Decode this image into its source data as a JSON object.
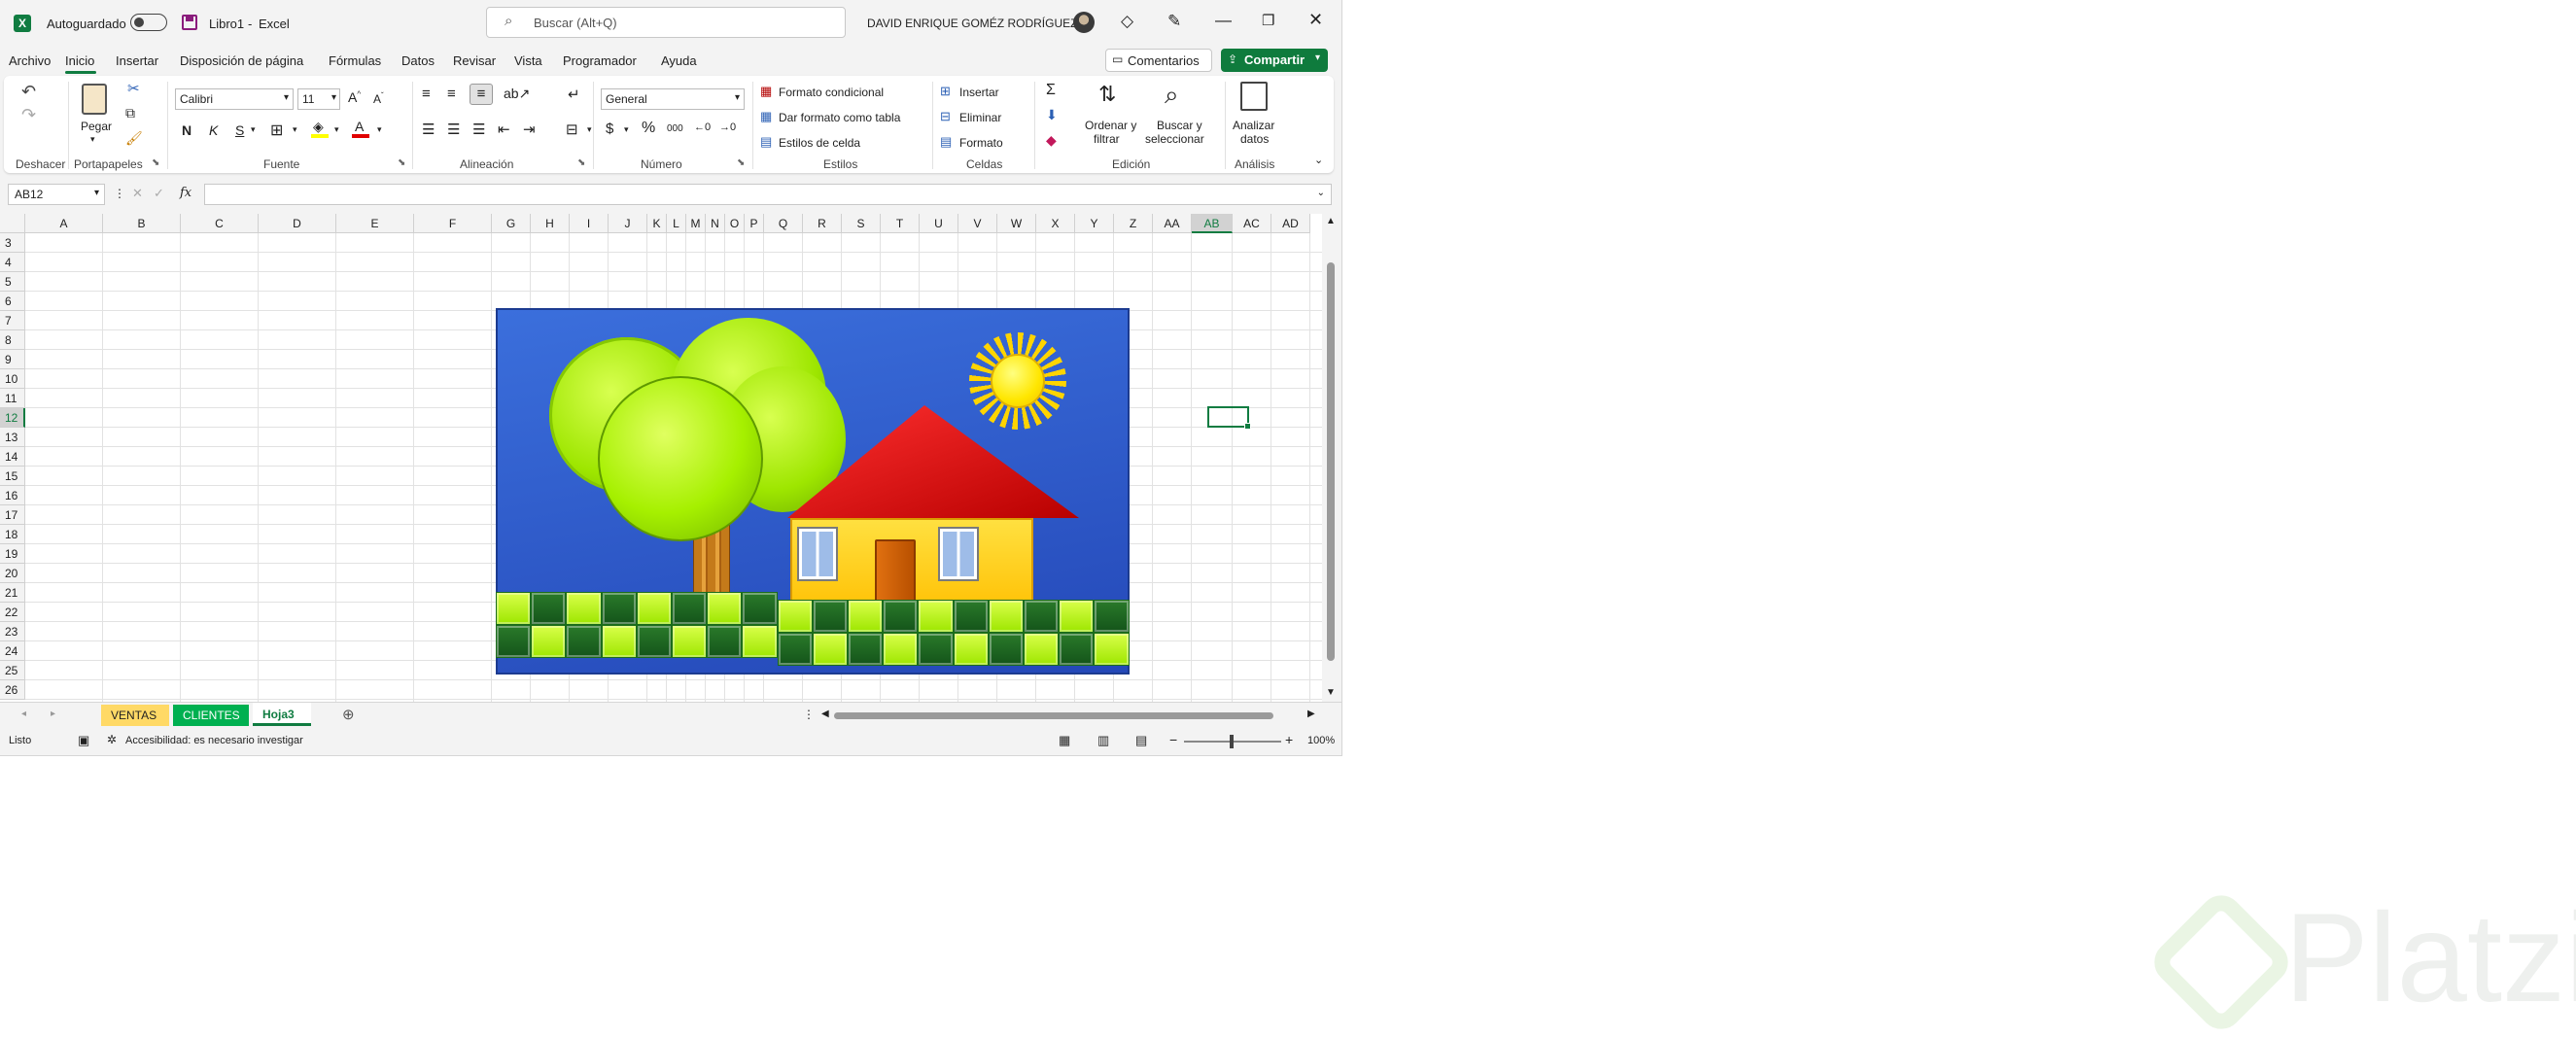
{
  "title_bar": {
    "autosave_label": "Autoguardado",
    "file_name": "Libro1",
    "separator": "-",
    "app_name": "Excel",
    "search_placeholder": "Buscar (Alt+Q)",
    "user_name": "DAVID ENRIQUE GOMÉZ  RODRÍGUEZ"
  },
  "menu_tabs": [
    "Archivo",
    "Inicio",
    "Insertar",
    "Disposición de página",
    "Fórmulas",
    "Datos",
    "Revisar",
    "Vista",
    "Programador",
    "Ayuda"
  ],
  "active_tab": "Inicio",
  "comments_label": "Comentarios",
  "share_label": "Compartir",
  "ribbon": {
    "groups": [
      "Deshacer",
      "Portapapeles",
      "Fuente",
      "Alineación",
      "Número",
      "Estilos",
      "Celdas",
      "Edición",
      "Análisis"
    ],
    "paste_label": "Pegar",
    "font_name": "Calibri",
    "font_size": "11",
    "bold": "N",
    "italic": "K",
    "underline": "S",
    "number_format": "General",
    "styles": [
      "Formato condicional",
      "Dar formato como tabla",
      "Estilos de celda"
    ],
    "cells": [
      "Insertar",
      "Eliminar",
      "Formato"
    ],
    "sort_filter": [
      "Ordenar y",
      "filtrar"
    ],
    "find_select": [
      "Buscar y",
      "seleccionar"
    ],
    "analyze": [
      "Analizar",
      "datos"
    ]
  },
  "formula_bar": {
    "name_box": "AB12",
    "formula": "",
    "fx": "fx"
  },
  "columns": [
    "A",
    "B",
    "C",
    "D",
    "E",
    "F",
    "G",
    "H",
    "I",
    "J",
    "K",
    "L",
    "M",
    "N",
    "O",
    "P",
    "Q",
    "R",
    "S",
    "T",
    "U",
    "V",
    "W",
    "X",
    "Y",
    "Z",
    "AA",
    "AB",
    "AC",
    "AD"
  ],
  "rows": [
    "3",
    "4",
    "5",
    "6",
    "7",
    "8",
    "9",
    "10",
    "11",
    "12",
    "13",
    "14",
    "15",
    "16",
    "17",
    "18",
    "19",
    "20",
    "21",
    "22",
    "23",
    "24",
    "25",
    "26"
  ],
  "selected_cell": "AB12",
  "sheet_tabs": [
    {
      "name": "VENTAS",
      "color": "#ffd966"
    },
    {
      "name": "CLIENTES",
      "color": "#00b050"
    },
    {
      "name": "Hoja3",
      "color": "#ffffff"
    }
  ],
  "active_sheet": "Hoja3",
  "status": {
    "ready": "Listo",
    "accessibility": "Accesibilidad: es necesario investigar",
    "zoom": "100%"
  },
  "watermark": "Platzi",
  "colors": {
    "excel_green": "#107c41",
    "share_green": "#0f7b3d",
    "sky": "#2c55c9",
    "tree": "#a6f000",
    "roof": "#d10000",
    "wall": "#ffcc00",
    "sun": "#ffee00"
  }
}
